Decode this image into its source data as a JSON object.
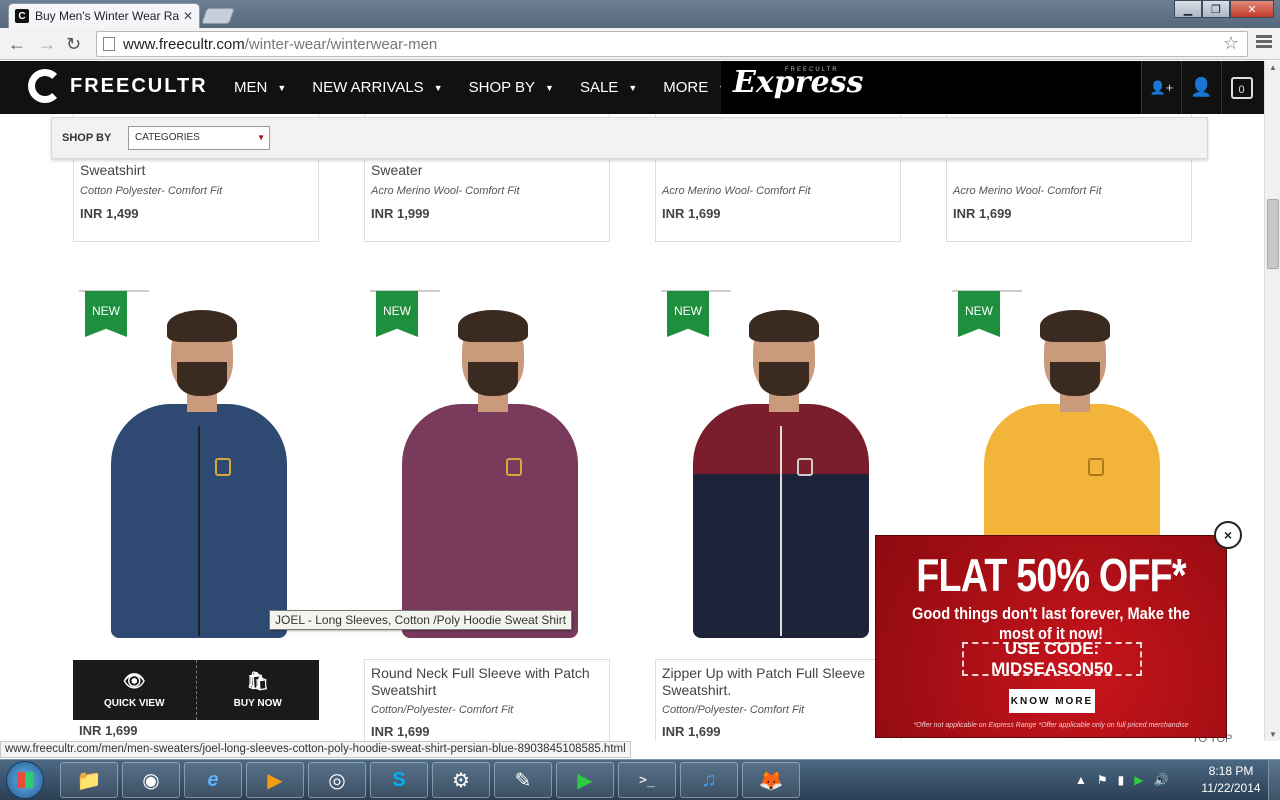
{
  "browser": {
    "tab_title": "Buy Men's Winter Wear Ra",
    "tab_close": "✕",
    "favicon_letter": "C",
    "url_host": "www.freecultr.com",
    "url_path": "/winter-wear/winterwear-men",
    "back_glyph": "←",
    "forward_glyph": "→",
    "reload_glyph": "↻",
    "star_glyph": "☆",
    "min_glyph": "▁",
    "max_glyph": "❐",
    "close_glyph": "✕"
  },
  "site": {
    "logo_text": "FREECULTR",
    "nav": [
      "MEN",
      "NEW ARRIVALS",
      "SHOP BY",
      "SALE",
      "MORE"
    ],
    "caret": "▼",
    "express_small": "FREECULTR",
    "express_text": "Express",
    "icons": [
      "add-user-icon",
      "user-icon",
      "cart-icon"
    ],
    "add_user_glyph": "👤+",
    "user_glyph": "👤",
    "cart_count": "0"
  },
  "filter": {
    "label": "SHOP BY",
    "select_value": "CATEGORIES",
    "select_arrow": "▼"
  },
  "top_row": [
    {
      "title": "Sweatshirt",
      "sub": "Cotton Polyester- Comfort Fit",
      "price": "INR 1,499"
    },
    {
      "title": "Sweater",
      "sub": "Acro Merino Wool- Comfort Fit",
      "price": "INR 1,999"
    },
    {
      "title": "",
      "sub": "Acro Merino Wool- Comfort Fit",
      "price": "INR 1,699"
    },
    {
      "title": "",
      "sub": "Acro Merino Wool- Comfort Fit",
      "price": "INR 1,699"
    }
  ],
  "products": [
    {
      "badge": "NEW",
      "title": "",
      "sub": "",
      "price": "INR 1,699",
      "color": "#2f4a72",
      "hood": "#8a9fb8"
    },
    {
      "badge": "NEW",
      "title": "Round Neck Full Sleeve with Patch Sweatshirt",
      "sub": "Cotton/Polyester- Comfort Fit",
      "price": "INR 1,699",
      "color": "#7a3a5c"
    },
    {
      "badge": "NEW",
      "title": "Zipper Up with Patch Full Sleeve Sweatshirt.",
      "sub": "Cotton/Polyester- Comfort Fit",
      "price": "INR 1,699",
      "color": "#1d2439",
      "top": "#7b1e2c"
    },
    {
      "badge": "NEW",
      "title": "",
      "sub": "",
      "price": "",
      "color": "#f2b53a"
    }
  ],
  "actions": {
    "quick_view": "QUICK VIEW",
    "buy_now": "BUY NOW",
    "eye_glyph": "👁",
    "bag_glyph": "🛍"
  },
  "tooltip": "JOEL - Long Sleeves, Cotton /Poly  Hoodie Sweat Shirt",
  "promo": {
    "title": "FLAT 50% OFF*",
    "tagline": "Good things don't last forever, Make the most of it now!",
    "code": "USE CODE: MIDSEASON50",
    "button": "KNOW MORE",
    "note": "*Offer not applicable on Express Range *Offer applicable only on full priced merchandise",
    "close": "×"
  },
  "to_top": "TO TOP",
  "status_url": "www.freecultr.com/men/men-sweaters/joel-long-sleeves-cotton-poly-hoodie-sweat-shirt-persian-blue-8903845108585.html",
  "taskbar": {
    "apps": [
      "explorer-icon",
      "eclipse-icon",
      "ie-icon",
      "media-player-icon",
      "chrome-icon",
      "skype-icon",
      "control-panel-icon",
      "notepad-icon",
      "play-icon",
      "cmd-icon",
      "itunes-icon",
      "firefox-icon"
    ],
    "glyphs": [
      "📁",
      "◉",
      "e",
      "▶",
      "◎",
      "S",
      "⚙",
      "✎",
      "▶",
      ">_",
      "♫",
      "🦊"
    ],
    "time": "8:18 PM",
    "date": "11/22/2014"
  }
}
